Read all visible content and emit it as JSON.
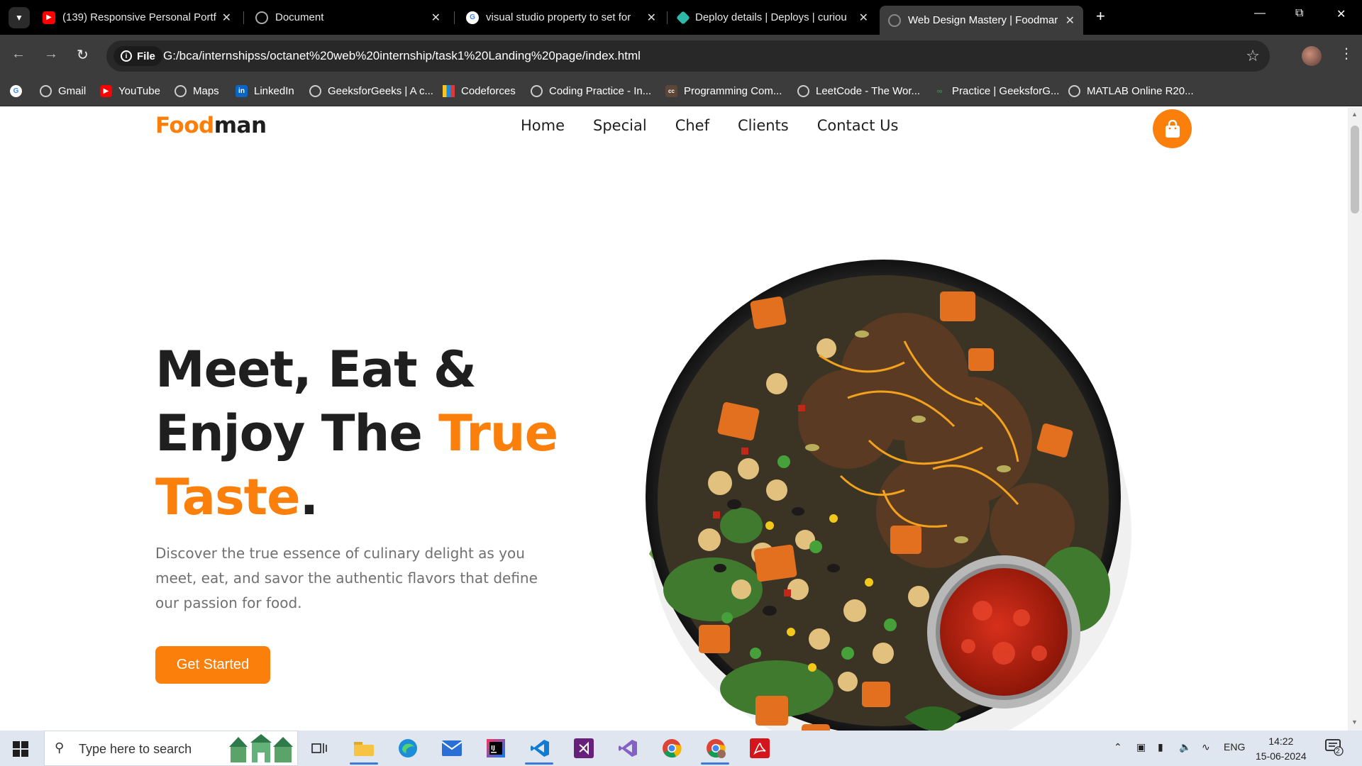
{
  "browser": {
    "tabs": [
      {
        "title": "(139) Responsive Personal Portf",
        "favicon": "youtube-icon"
      },
      {
        "title": "Document",
        "favicon": "globe-icon"
      },
      {
        "title": "visual studio property to set for",
        "favicon": "google-icon"
      },
      {
        "title": "Deploy details | Deploys | curiou",
        "favicon": "netlify-icon"
      },
      {
        "title": "Web Design Mastery | Foodmar",
        "favicon": "globe-icon",
        "active": true
      }
    ],
    "address": {
      "chip": "File",
      "url": "G:/bca/internshipss/octanet%20web%20internship/task1%20Landing%20page/index.html"
    },
    "bookmarks": [
      {
        "label": "",
        "icon": "google-icon"
      },
      {
        "label": "Gmail",
        "icon": "globe-icon"
      },
      {
        "label": "YouTube",
        "icon": "youtube-icon"
      },
      {
        "label": "Maps",
        "icon": "globe-icon"
      },
      {
        "label": "LinkedIn",
        "icon": "linkedin-icon"
      },
      {
        "label": "GeeksforGeeks | A c...",
        "icon": "globe-icon"
      },
      {
        "label": "Codeforces",
        "icon": "codeforces-icon"
      },
      {
        "label": "Coding Practice - In...",
        "icon": "globe-icon"
      },
      {
        "label": "Programming Com...",
        "icon": "codechef-icon"
      },
      {
        "label": "LeetCode - The Wor...",
        "icon": "globe-icon"
      },
      {
        "label": "Practice | GeeksforG...",
        "icon": "gfg-icon"
      },
      {
        "label": "MATLAB Online R20...",
        "icon": "globe-icon"
      }
    ]
  },
  "site": {
    "logo": {
      "accent": "Food",
      "rest": "man"
    },
    "nav": [
      "Home",
      "Special",
      "Chef",
      "Clients",
      "Contact Us"
    ],
    "hero": {
      "line1": "Meet, Eat &",
      "line2_plain": "Enjoy The ",
      "line2_accent": "True",
      "line3_accent": "Taste",
      "line3_end": ".",
      "description": "Discover the true essence of culinary delight as you meet, eat, and savor the authentic flavors that define our passion for food.",
      "cta": "Get Started"
    },
    "colors": {
      "accent": "#fb7f0b",
      "text": "#1f1f1f",
      "muted": "#707070"
    }
  },
  "taskbar": {
    "search_placeholder": "Type here to search",
    "apps": [
      "task-view-icon",
      "file-explorer-icon",
      "edge-icon",
      "mail-icon",
      "intellij-icon",
      "vscode-icon",
      "visual-studio-icon",
      "visual-studio-preview-icon",
      "chrome-icon",
      "chrome-profile-icon",
      "acrobat-icon"
    ],
    "language": "ENG",
    "time": "14:22",
    "date": "15-06-2024",
    "notifications": "2"
  }
}
